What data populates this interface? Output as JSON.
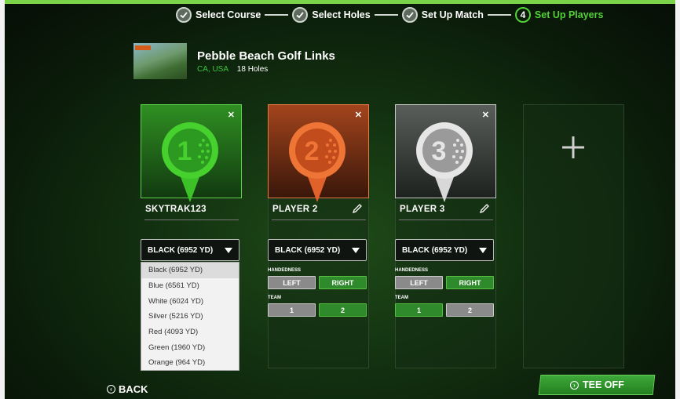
{
  "stepper": {
    "steps": [
      {
        "label": "Select Course",
        "state": "done",
        "icon": "check-icon"
      },
      {
        "label": "Select Holes",
        "state": "done",
        "icon": "check-icon"
      },
      {
        "label": "Set Up Match",
        "state": "done",
        "icon": "check-icon"
      },
      {
        "label": "Set Up Players",
        "state": "active",
        "number": "4"
      }
    ]
  },
  "course": {
    "name": "Pebble Beach Golf Links",
    "location": "CA, USA",
    "holes": "18 Holes"
  },
  "players": [
    {
      "name": "SKYTRAK123",
      "number": "1",
      "color": "#3cc228",
      "tee": "BLACK (6952 YD)",
      "editable": false
    },
    {
      "name": "PLAYER 2",
      "number": "2",
      "color": "#e0622a",
      "tee": "BLACK (6952 YD)",
      "handedness_label": "HANDEDNESS",
      "left": "LEFT",
      "right": "RIGHT",
      "handedness": "RIGHT",
      "team_label": "TEAM",
      "team_1": "1",
      "team_2": "2",
      "team": "2"
    },
    {
      "name": "PLAYER 3",
      "number": "3",
      "color": "#d8d8d8",
      "tee": "BLACK (6952 YD)",
      "handedness_label": "HANDEDNESS",
      "left": "LEFT",
      "right": "RIGHT",
      "handedness": "RIGHT",
      "team_label": "TEAM",
      "team_1": "1",
      "team_2": "2",
      "team": "1"
    }
  ],
  "tee_options": [
    "Black (6952 YD)",
    "Blue (6561 YD)",
    "White (6024 YD)",
    "Silver (5216 YD)",
    "Red (4093 YD)",
    "Green (1960 YD)",
    "Orange (964 YD)"
  ],
  "nav": {
    "back": "BACK",
    "tee_off": "TEE OFF"
  },
  "colors": {
    "accent": "#53d137",
    "segment_on": "#2e8a2a",
    "segment_off": "#8a8a8a"
  }
}
